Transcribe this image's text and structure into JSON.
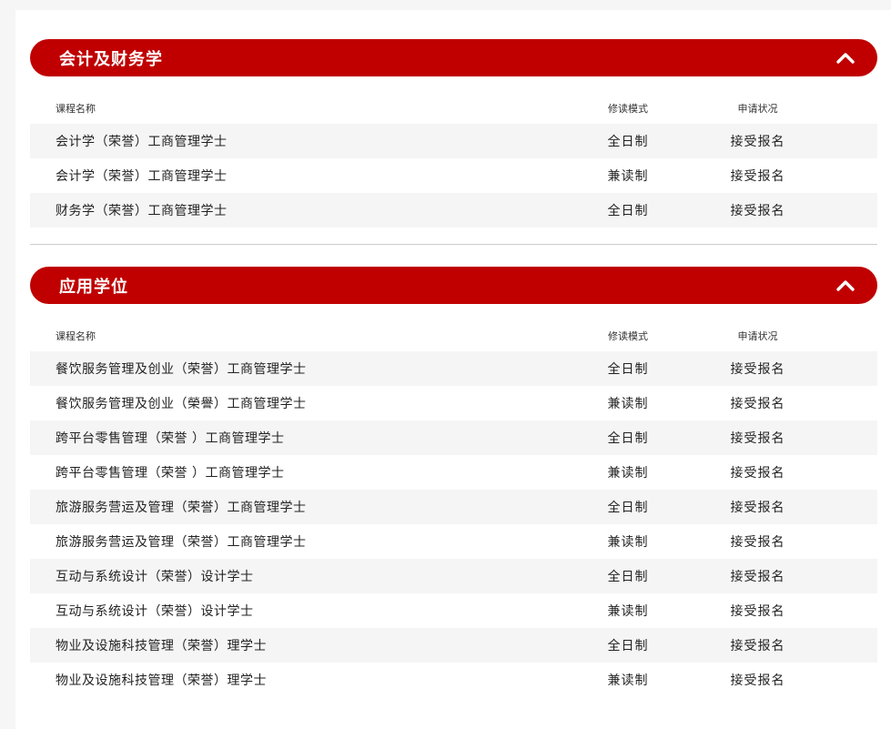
{
  "columns": {
    "name": "课程名称",
    "mode": "修读模式",
    "status": "申请状况"
  },
  "sections": [
    {
      "title": "会计及财务学",
      "rows": [
        {
          "name": "会计学（荣誉）工商管理学士",
          "mode": "全日制",
          "status": "接受报名"
        },
        {
          "name": "会计学（荣誉）工商管理学士",
          "mode": "兼读制",
          "status": "接受报名"
        },
        {
          "name": "财务学（荣誉）工商管理学士",
          "mode": "全日制",
          "status": "接受报名"
        }
      ]
    },
    {
      "title": "应用学位",
      "rows": [
        {
          "name": "餐饮服务管理及创业（荣誉）工商管理学士",
          "mode": "全日制",
          "status": "接受报名"
        },
        {
          "name": "餐饮服务管理及创业（榮譽）工商管理学士",
          "mode": "兼读制",
          "status": "接受报名"
        },
        {
          "name": "跨平台零售管理（荣誉 ）工商管理学士",
          "mode": "全日制",
          "status": "接受报名"
        },
        {
          "name": "跨平台零售管理（荣誉 ）工商管理学士",
          "mode": "兼读制",
          "status": "接受报名"
        },
        {
          "name": "旅游服务营运及管理（荣誉）工商管理学士",
          "mode": "全日制",
          "status": "接受报名"
        },
        {
          "name": "旅游服务营运及管理（荣誉）工商管理学士",
          "mode": "兼读制",
          "status": "接受报名"
        },
        {
          "name": "互动与系统设计（荣誉）设计学士",
          "mode": "全日制",
          "status": "接受报名"
        },
        {
          "name": "互动与系统设计（荣誉）设计学士",
          "mode": "兼读制",
          "status": "接受报名"
        },
        {
          "name": "物业及设施科技管理（荣誉）理学士",
          "mode": "全日制",
          "status": "接受报名"
        },
        {
          "name": "物业及设施科技管理（荣誉）理学士",
          "mode": "兼读制",
          "status": "接受报名"
        }
      ]
    }
  ],
  "colors": {
    "accent": "#c00000",
    "row_alt": "#f5f5f5"
  },
  "icons": {
    "toggle": "chevron-up-icon"
  }
}
